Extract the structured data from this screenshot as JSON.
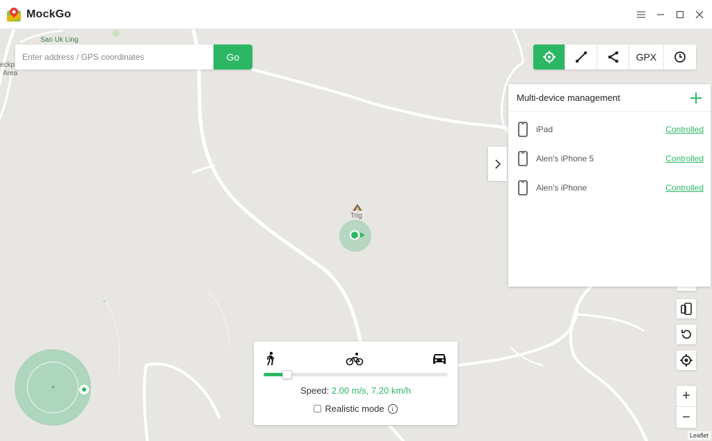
{
  "app": {
    "title": "MockGo"
  },
  "window_controls": [
    {
      "name": "menu-icon"
    },
    {
      "name": "minimize-icon"
    },
    {
      "name": "maximize-icon"
    },
    {
      "name": "close-icon"
    }
  ],
  "search": {
    "placeholder": "Enter address / GPS coordinates",
    "value": "",
    "go_label": "Go"
  },
  "modes": [
    {
      "name": "teleport-mode-icon",
      "active": true
    },
    {
      "name": "two-spot-route-icon",
      "active": false
    },
    {
      "name": "multi-spot-route-icon",
      "active": false
    },
    {
      "name": "gpx-import",
      "label": "GPX",
      "active": false
    },
    {
      "name": "history-icon",
      "active": false
    }
  ],
  "device_panel": {
    "title": "Multi-device management",
    "devices": [
      {
        "name": "iPad",
        "status": "Controlled"
      },
      {
        "name": "Alen's iPhone 5",
        "status": "Controlled"
      },
      {
        "name": "Alen's iPhone",
        "status": "Controlled"
      }
    ]
  },
  "map": {
    "labels": {
      "village": "San Uk Ling",
      "left_edge": "eckp.",
      "left_edge2": "Area",
      "trig": "Trig"
    },
    "attribution": "Leaflet"
  },
  "zoom": {
    "in_label": "+",
    "out_label": "−"
  },
  "speed_panel": {
    "speed_label": "Speed: ",
    "speed_value": "2.00 m/s, 7.20 km/h",
    "realistic_label": "Realistic mode",
    "realistic_checked": false,
    "info_label": "i",
    "slider_fraction": 0.13,
    "modes": [
      "walking-icon",
      "cycling-icon",
      "driving-icon"
    ]
  },
  "colors": {
    "accent": "#2cb764",
    "map_bg": "#e8e6e3"
  }
}
